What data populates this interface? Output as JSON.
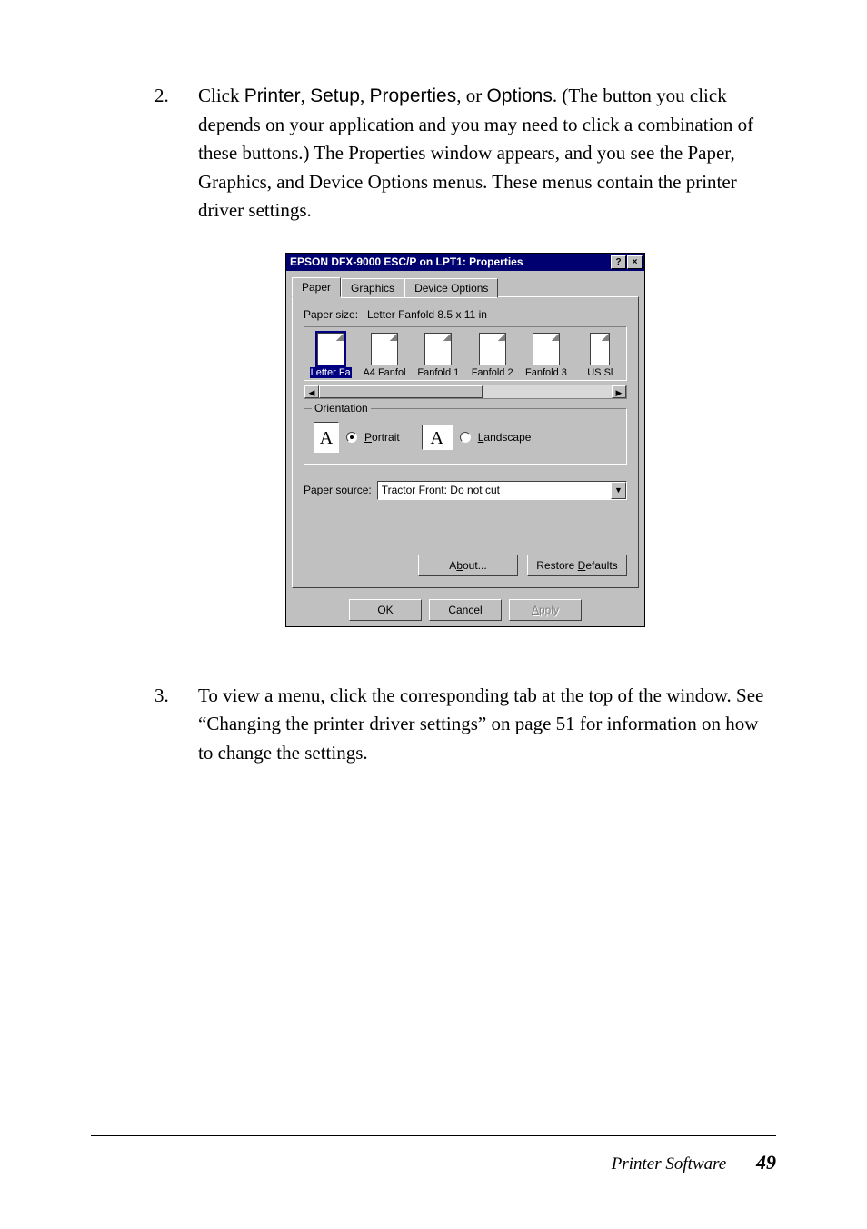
{
  "items": {
    "n2": {
      "num": "2.",
      "pre": "Click ",
      "printer": "Printer",
      "c1": ", ",
      "setup": "Setup",
      "c2": ", ",
      "properties": "Properties",
      "c3": ", or ",
      "options": "Options",
      "post": ". (The button you click depends on your application and you may need to click a combination of these buttons.) The Properties window appears, and you see the Paper, Graphics, and Device Options menus. These menus contain the printer driver settings."
    },
    "n3": {
      "num": "3.",
      "text": "To view a menu, click the corresponding tab at the top of the window. See “Changing the printer driver settings” on page 51 for information on how to change the settings."
    }
  },
  "dialog": {
    "title": "EPSON DFX-9000 ESC/P on LPT1: Properties",
    "help": "?",
    "close": "×",
    "tabs": {
      "t1": "Paper",
      "t2": "Graphics",
      "t3": "Device Options"
    },
    "paper_size_label": "Paper size:",
    "paper_size_value": "Letter Fanfold 8.5 x 11 in",
    "paper_items": {
      "p1": "Letter Fa",
      "p2": "A4 Fanfol",
      "p3": "Fanfold 1",
      "p4": "Fanfold 2",
      "p5": "Fanfold 3",
      "p6": "US Sl"
    },
    "scroll": {
      "left": "◀",
      "right": "▶"
    },
    "orientation": {
      "title": "Orientation",
      "iconA": "A",
      "iconB": "A",
      "portrait_pre": "P",
      "portrait_rest": "ortrait",
      "landscape_pre": "L",
      "landscape_rest": "andscape"
    },
    "source": {
      "label_pre": "Paper ",
      "label_u": "s",
      "label_post": "ource:",
      "value": "Tractor Front: Do not cut"
    },
    "buttons": {
      "about_pre": "A",
      "about_u": "b",
      "about_post": "out...",
      "restore_pre": "Restore ",
      "restore_u": "D",
      "restore_post": "efaults",
      "ok": "OK",
      "cancel": "Cancel",
      "apply_pre": "A",
      "apply_rest": "pply"
    }
  },
  "footer": {
    "section": "Printer Software",
    "page": "49"
  }
}
